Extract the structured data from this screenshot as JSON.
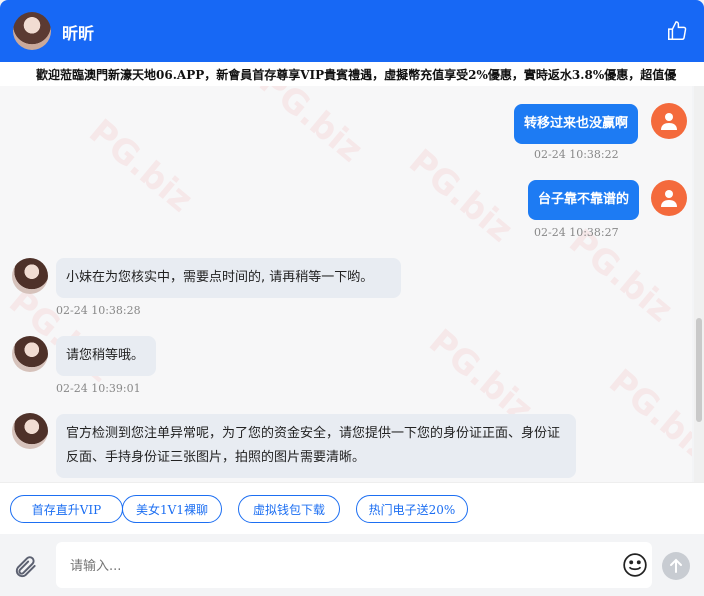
{
  "header": {
    "title": "昕昕"
  },
  "marquee": {
    "text": "歡迎蒞臨澳門新濠天地06.APP，新會員首存尊享VIP貴賓禮遇，虛擬幣充值享受2%優惠，實時返水3.8%優惠，超值優"
  },
  "watermark": "PG.biz",
  "messages": [
    {
      "from": "user",
      "text": "转移过来也没赢啊",
      "time": "02-24 10:38:22"
    },
    {
      "from": "user",
      "text": "台子靠不靠谱的",
      "time": "02-24 10:38:27"
    },
    {
      "from": "agent",
      "text": "小妹在为您核实中，需要点时间的, 请再稍等一下哟。",
      "time": "02-24 10:38:28"
    },
    {
      "from": "agent",
      "text": "请您稍等哦。",
      "time": "02-24 10:39:01"
    },
    {
      "from": "agent",
      "text": "官方检测到您注单异常呢，为了您的资金安全，请您提供一下您的身份证正面、身份证反面、手持身份证三张图片，拍照的图片需要清晰。",
      "time": ""
    }
  ],
  "quick_replies": [
    "首存直升VIP",
    "美女1V1裸聊",
    "虚拟钱包下载",
    "热门电子送20%"
  ],
  "input": {
    "placeholder": "请输入..."
  },
  "icons": {
    "like": "thumbs-up-icon",
    "attach": "paperclip-icon",
    "emoji": "smiley-icon",
    "send": "send-arrow-icon"
  },
  "colors": {
    "header": "#1768f5",
    "user_bubble": "#1d7bf3",
    "agent_bubble": "#e8ecf2",
    "user_avatar": "#f46a3c"
  }
}
